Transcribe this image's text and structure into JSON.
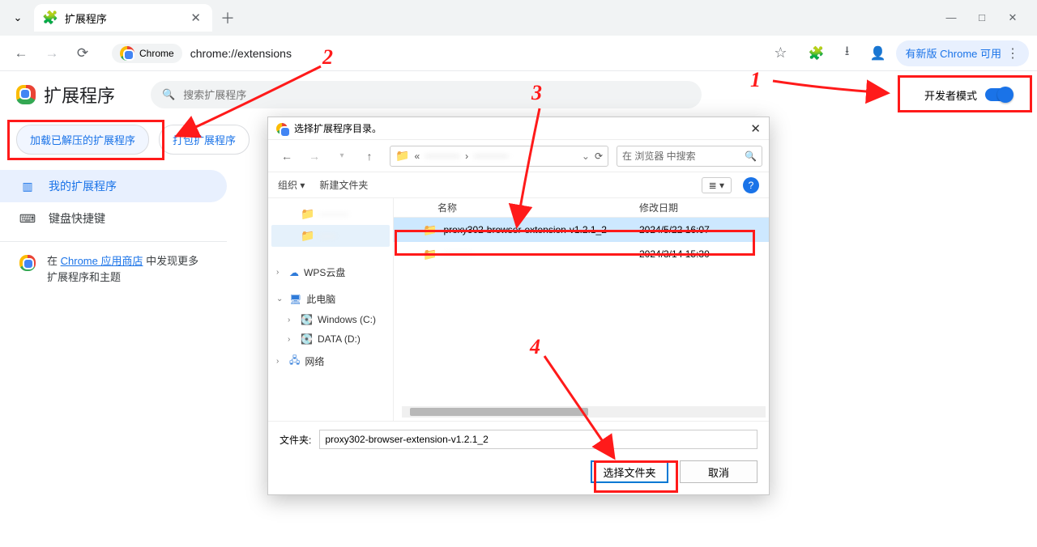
{
  "tab": {
    "title": "扩展程序"
  },
  "omnibox": {
    "chip": "Chrome",
    "url": "chrome://extensions"
  },
  "update_pill": "有新版 Chrome 可用",
  "ext": {
    "title": "扩展程序",
    "search_placeholder": "搜索扩展程序",
    "dev_mode_label": "开发者模式",
    "load_unpacked": "加载已解压的扩展程序",
    "pack_extension": "打包扩展程序"
  },
  "sidebar": {
    "my_extensions": "我的扩展程序",
    "shortcuts": "键盘快捷键",
    "store_line_prefix": "在 ",
    "store_link": "Chrome 应用商店",
    "store_line_suffix": " 中发现更多扩展程序和主题"
  },
  "dialog": {
    "title": "选择扩展程序目录。",
    "organize": "组织",
    "new_folder": "新建文件夹",
    "search_placeholder": "在 浏览器 中搜索",
    "col_name": "名称",
    "col_date": "修改日期",
    "rows": [
      {
        "name": "proxy302-browser-extension-v1.2.1_2",
        "date": "2024/5/22 16:07",
        "selected": true,
        "blurred": false
      },
      {
        "name": "",
        "date": "2024/3/14 15:30",
        "selected": false,
        "blurred": true
      }
    ],
    "tree": {
      "wps": "WPS云盘",
      "this_pc": "此电脑",
      "win_c": "Windows (C:)",
      "data_d": "DATA (D:)",
      "network": "网络"
    },
    "folder_label": "文件夹:",
    "folder_value": "proxy302-browser-extension-v1.2.1_2",
    "select_button": "选择文件夹",
    "cancel_button": "取消"
  },
  "annotations": {
    "n1": "1",
    "n2": "2",
    "n3": "3",
    "n4": "4"
  }
}
